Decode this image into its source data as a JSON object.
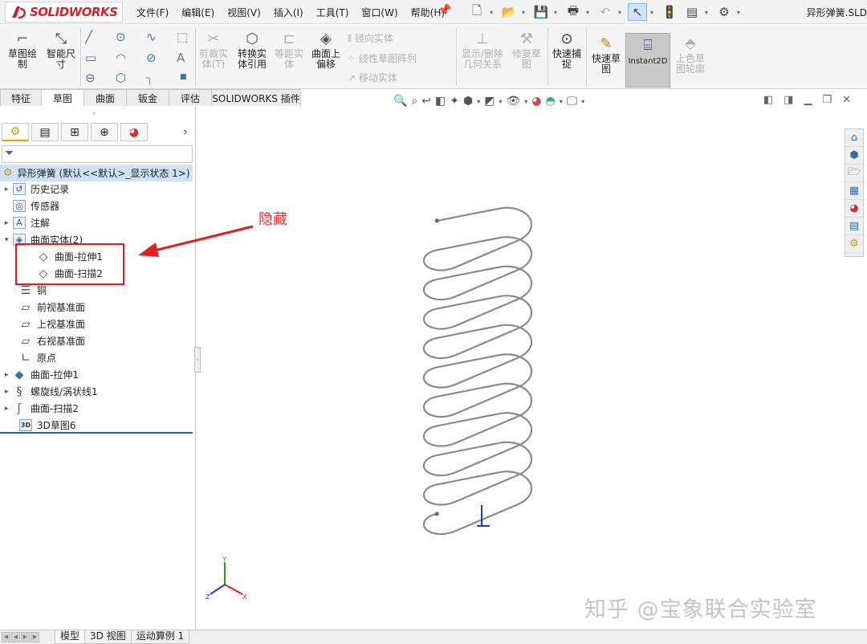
{
  "app": {
    "logo": "SOLIDWORKS",
    "doc_title": "异形弹簧.SLD"
  },
  "menu": [
    "文件(F)",
    "编辑(E)",
    "视图(V)",
    "插入(I)",
    "工具(T)",
    "窗口(W)",
    "帮助(H)"
  ],
  "commands": {
    "sketch": "草图绘\n制",
    "smart_dim": "智能尺\n寸",
    "trim": "剪裁实\n体(T)",
    "convert": "转换实\n体引用",
    "offset_ent": "等距实\n体",
    "offset_surface": "曲面上\n偏移",
    "mirror": "镜向实体",
    "linear_pattern": "线性草图阵列",
    "move": "移动实体",
    "display_delete": "显示/删除\n几何关系",
    "repair": "修复草\n图",
    "quick_snap": "快速捕\n捉",
    "rapid_sketch": "快速草\n图",
    "instant2d": "Instant2D",
    "shaded": "上色草\n图轮廓"
  },
  "tabs": [
    "特征",
    "草图",
    "曲面",
    "钣金",
    "评估",
    "SOLIDWORKS 插件"
  ],
  "active_tab": "草图",
  "tree": {
    "root": "异形弹簧  (默认<<默认>_显示状态 1>)",
    "items": [
      {
        "label": "历史记录",
        "expand": "▸",
        "icon": "history-icon"
      },
      {
        "label": "传感器",
        "expand": "",
        "icon": "sensor-icon"
      },
      {
        "label": "注解",
        "expand": "▸",
        "icon": "annotation-icon"
      },
      {
        "label": "曲面实体(2)",
        "expand": "▾",
        "icon": "surface-bodies-icon"
      },
      {
        "label": "曲面-拉伸1",
        "expand": "",
        "icon": "surface-icon"
      },
      {
        "label": "曲面-扫描2",
        "expand": "",
        "icon": "surface-icon"
      },
      {
        "label": "铜",
        "expand": "",
        "icon": "material-icon"
      },
      {
        "label": "前视基准面",
        "expand": "",
        "icon": "plane-icon"
      },
      {
        "label": "上视基准面",
        "expand": "",
        "icon": "plane-icon"
      },
      {
        "label": "右视基准面",
        "expand": "",
        "icon": "plane-icon"
      },
      {
        "label": "原点",
        "expand": "",
        "icon": "origin-icon"
      },
      {
        "label": "曲面-拉伸1",
        "expand": "▸",
        "icon": "extrude-icon"
      },
      {
        "label": "螺旋线/涡状线1",
        "expand": "▸",
        "icon": "helix-icon"
      },
      {
        "label": "曲面-扫描2",
        "expand": "▸",
        "icon": "sweep-icon"
      },
      {
        "label": "3D草图6",
        "expand": "",
        "icon": "sketch3d-icon"
      }
    ]
  },
  "annotation": "隐藏",
  "triad": {
    "y": "Y",
    "z": "Z",
    "x": "X"
  },
  "watermark": "知乎 @宝象联合实验室",
  "bottom_tabs": [
    "模型",
    "3D 视图",
    "运动算例 1"
  ],
  "colors": {
    "accent_red": "#e02020",
    "selection": "#cde2f8",
    "spring": "#8a8a8a"
  }
}
